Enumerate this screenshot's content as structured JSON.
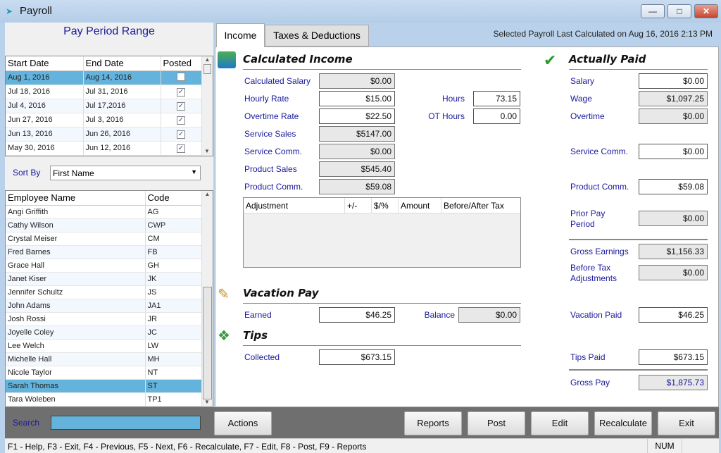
{
  "window": {
    "title": "Payroll",
    "controls": [
      "minimize",
      "maximize",
      "close"
    ]
  },
  "pay_period": {
    "title": "Pay Period Range",
    "columns": [
      "Start Date",
      "End Date",
      "Posted"
    ],
    "rows": [
      [
        "Aug 1, 2016",
        "Aug 14, 2016",
        false
      ],
      [
        "Jul 18, 2016",
        "Jul 31, 2016",
        true
      ],
      [
        "Jul 4, 2016",
        "Jul 17,2016",
        true
      ],
      [
        "Jun 27, 2016",
        "Jul 3, 2016",
        true
      ],
      [
        "Jun 13, 2016",
        "Jun 26, 2016",
        true
      ],
      [
        "May 30, 2016",
        "Jun 12, 2016",
        true
      ]
    ],
    "selected_index": 0
  },
  "sort": {
    "label": "Sort By",
    "value": "First Name"
  },
  "employees": {
    "columns": [
      "Employee Name",
      "Code"
    ],
    "rows": [
      [
        "Angi Griffith",
        "AG"
      ],
      [
        "Cathy Wilson",
        "CWP"
      ],
      [
        "Crystal Meiser",
        "CM"
      ],
      [
        "Fred Barnes",
        "FB"
      ],
      [
        "Grace Hall",
        "GH"
      ],
      [
        "Janet Kiser",
        "JK"
      ],
      [
        "Jennifer Schultz",
        "JS"
      ],
      [
        "John Adams",
        "JA1"
      ],
      [
        "Josh Rossi",
        "JR"
      ],
      [
        "Joyelle Coley",
        "JC"
      ],
      [
        "Lee Welch",
        "LW"
      ],
      [
        "Michelle Hall",
        "MH"
      ],
      [
        "Nicole Taylor",
        "NT"
      ],
      [
        "Sarah Thomas",
        "ST"
      ],
      [
        "Tara Woleben",
        "TP1"
      ]
    ],
    "selected_index": 13
  },
  "search": {
    "label": "Search",
    "value": ""
  },
  "tabs": [
    {
      "label": "Income",
      "active": true
    },
    {
      "label": "Taxes & Deductions",
      "active": false
    }
  ],
  "last_calculated": "Selected Payroll Last Calculated on Aug 16, 2016 2:13 PM",
  "calculated_income": {
    "title": "Calculated Income",
    "calculated_salary": {
      "label": "Calculated Salary",
      "value": "$0.00"
    },
    "hourly_rate": {
      "label": "Hourly Rate",
      "value": "$15.00"
    },
    "overtime_rate": {
      "label": "Overtime Rate",
      "value": "$22.50"
    },
    "service_sales": {
      "label": "Service Sales",
      "value": "$5147.00"
    },
    "service_comm": {
      "label": "Service Comm.",
      "value": "$0.00"
    },
    "product_sales": {
      "label": "Product Sales",
      "value": "$545.40"
    },
    "product_comm": {
      "label": "Product Comm.",
      "value": "$59.08"
    },
    "hours": {
      "label": "Hours",
      "value": "73.15"
    },
    "ot_hours": {
      "label": "OT Hours",
      "value": "0.00"
    },
    "adjustments": {
      "columns": [
        "Adjustment",
        "+/-",
        "$/%",
        "Amount",
        "Before/After Tax"
      ]
    }
  },
  "vacation_pay": {
    "title": "Vacation Pay",
    "earned": {
      "label": "Earned",
      "value": "$46.25"
    },
    "balance": {
      "label": "Balance",
      "value": "$0.00"
    }
  },
  "tips": {
    "title": "Tips",
    "collected": {
      "label": "Collected",
      "value": "$673.15"
    }
  },
  "actually_paid": {
    "title": "Actually Paid",
    "salary": {
      "label": "Salary",
      "value": "$0.00"
    },
    "wage": {
      "label": "Wage",
      "value": "$1,097.25"
    },
    "overtime": {
      "label": "Overtime",
      "value": "$0.00"
    },
    "service_comm": {
      "label": "Service Comm.",
      "value": "$0.00"
    },
    "product_comm": {
      "label": "Product Comm.",
      "value": "$59.08"
    },
    "prior_pay_period": {
      "label1": "Prior Pay",
      "label2": "Period",
      "value": "$0.00"
    },
    "gross_earnings": {
      "label": "Gross Earnings",
      "value": "$1,156.33"
    },
    "before_tax_adj": {
      "label1": "Before Tax",
      "label2": "Adjustments",
      "value": "$0.00"
    },
    "vacation_paid": {
      "label": "Vacation Paid",
      "value": "$46.25"
    },
    "tips_paid": {
      "label": "Tips Paid",
      "value": "$673.15"
    },
    "gross_pay": {
      "label": "Gross Pay",
      "value": "$1,875.73"
    }
  },
  "buttons": {
    "actions": "Actions",
    "reports": "Reports",
    "post": "Post",
    "edit": "Edit",
    "recalculate": "Recalculate",
    "exit": "Exit"
  },
  "status": {
    "help": "F1 - Help, F3 - Exit, F4 - Previous, F5 - Next, F6 - Recalculate, F7 - Edit, F8 - Post, F9 - Reports",
    "num": "NUM"
  },
  "colors": {
    "selection": "#64b3dc",
    "label": "#1a1a9c",
    "section_line": "#3399ee",
    "button_bar": "#6f6f6f"
  }
}
